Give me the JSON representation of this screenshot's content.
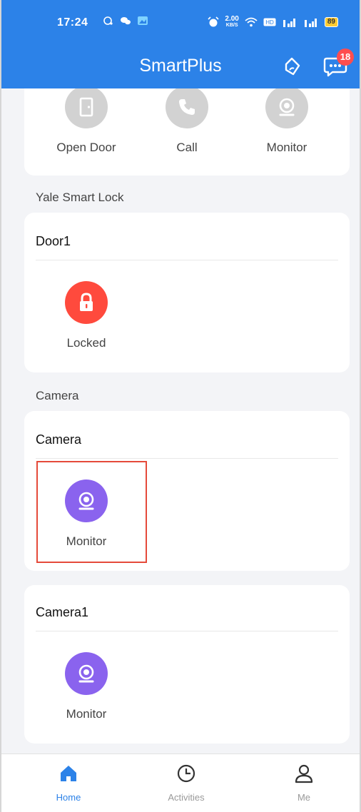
{
  "status_bar": {
    "time": "17:24",
    "speed_value": "2.00",
    "speed_unit": "KB/S",
    "battery": "89"
  },
  "header": {
    "title": "SmartPlus",
    "message_badge": "18"
  },
  "top_actions": [
    {
      "label": "Open Door",
      "icon": "door-icon"
    },
    {
      "label": "Call",
      "icon": "phone-icon"
    },
    {
      "label": "Monitor",
      "icon": "camera-icon"
    }
  ],
  "lock_section": {
    "label": "Yale Smart Lock",
    "card_title": "Door1",
    "action_label": "Locked",
    "icon": "lock-icon"
  },
  "camera_section": {
    "label": "Camera",
    "cards": [
      {
        "title": "Camera",
        "action_label": "Monitor",
        "icon": "camera-icon"
      },
      {
        "title": "Camera1",
        "action_label": "Monitor",
        "icon": "camera-icon"
      }
    ]
  },
  "bottom_nav": [
    {
      "label": "Home",
      "icon": "home-icon",
      "active": true
    },
    {
      "label": "Activities",
      "icon": "clock-icon",
      "active": false
    },
    {
      "label": "Me",
      "icon": "person-icon",
      "active": false
    }
  ],
  "colors": {
    "primary": "#2c82e8",
    "lock_red": "#ff4a3d",
    "camera_purple": "#8a63ee",
    "disabled_grey": "#d2d2d2",
    "highlight_border": "#e54a3a"
  }
}
